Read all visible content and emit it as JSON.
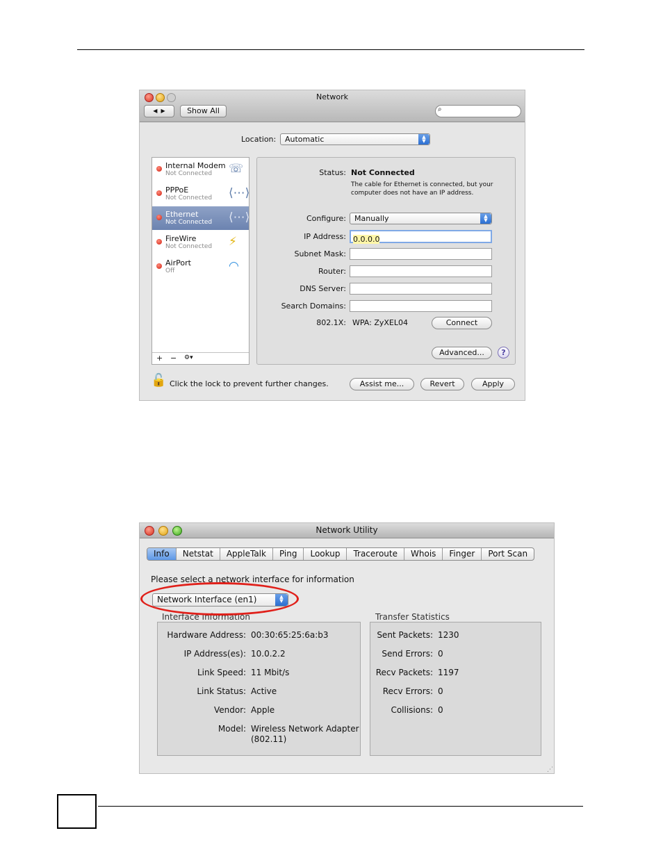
{
  "network": {
    "title": "Network",
    "show_all": "Show All",
    "location_label": "Location:",
    "location_value": "Automatic",
    "services": [
      {
        "name": "Internal Modem",
        "status": "Not Connected"
      },
      {
        "name": "PPPoE",
        "status": "Not Connected"
      },
      {
        "name": "Ethernet",
        "status": "Not Connected"
      },
      {
        "name": "FireWire",
        "status": "Not Connected"
      },
      {
        "name": "AirPort",
        "status": "Off"
      }
    ],
    "sidebar_footer": {
      "add": "+",
      "remove": "−",
      "action": "⚙▾"
    },
    "status_label": "Status:",
    "status_value": "Not Connected",
    "status_desc": "The cable for Ethernet is connected, but your computer does not have an IP address.",
    "configure_label": "Configure:",
    "configure_value": "Manually",
    "ip_label": "IP Address:",
    "ip_value": "0.0.0.0",
    "subnet_label": "Subnet Mask:",
    "router_label": "Router:",
    "dns_label": "DNS Server:",
    "search_domains_label": "Search Domains:",
    "dot1x_label": "802.1X:",
    "dot1x_value": "WPA: ZyXEL04",
    "connect": "Connect",
    "advanced": "Advanced...",
    "help": "?",
    "lock_text": "Click the lock to prevent further changes.",
    "assist": "Assist me...",
    "revert": "Revert",
    "apply": "Apply"
  },
  "utility": {
    "title": "Network Utility",
    "tabs": [
      "Info",
      "Netstat",
      "AppleTalk",
      "Ping",
      "Lookup",
      "Traceroute",
      "Whois",
      "Finger",
      "Port Scan"
    ],
    "prompt": "Please select a network interface for information",
    "interface_value": "Network Interface (en1)",
    "interface_group": "Interface Information",
    "transfer_group": "Transfer Statistics",
    "interface_rows": [
      {
        "label": "Hardware Address:",
        "value": "00:30:65:25:6a:b3"
      },
      {
        "label": "IP Address(es):",
        "value": "10.0.2.2"
      },
      {
        "label": "Link Speed:",
        "value": "11 Mbit/s"
      },
      {
        "label": "Link Status:",
        "value": "Active"
      },
      {
        "label": "Vendor:",
        "value": "Apple"
      },
      {
        "label": "Model:",
        "value": "Wireless Network Adapter"
      }
    ],
    "model_extra": "(802.11)",
    "transfer_rows": [
      {
        "label": "Sent Packets:",
        "value": "1230"
      },
      {
        "label": "Send Errors:",
        "value": "0"
      },
      {
        "label": "Recv Packets:",
        "value": "1197"
      },
      {
        "label": "Recv Errors:",
        "value": "0"
      },
      {
        "label": "Collisions:",
        "value": "0"
      }
    ]
  },
  "colors": {
    "highlight_ellipse": "#e0201a",
    "selected_row": "#7a8fb9",
    "active_tab": "#5e98e6"
  }
}
